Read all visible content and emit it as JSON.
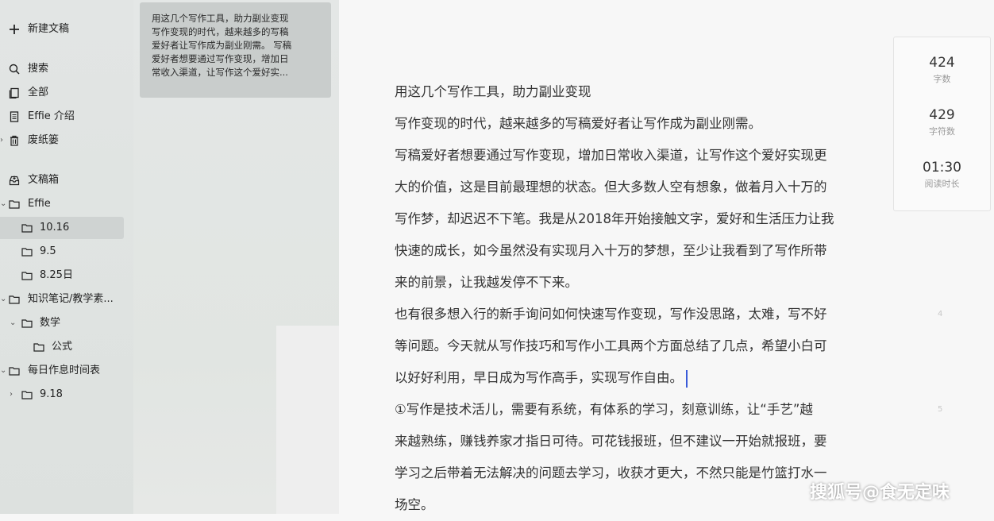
{
  "sidebar": {
    "new_doc": "新建文稿",
    "search": "搜索",
    "all": "全部",
    "intro": "Effie 介绍",
    "trash": "废纸篓",
    "inbox": "文稿箱",
    "folders": [
      {
        "label": "Effie"
      },
      {
        "label": "10.16"
      },
      {
        "label": "9.5"
      },
      {
        "label": "8.25日"
      },
      {
        "label": "知识笔记/教学素..."
      },
      {
        "label": "数学"
      },
      {
        "label": "公式"
      },
      {
        "label": "每日作息时间表"
      },
      {
        "label": "9.18"
      }
    ]
  },
  "card": {
    "lines": [
      "用这几个写作工具，助力副业变现",
      "写作变现的时代，越来越多的写稿",
      "爱好者让写作成为副业刚需。 写稿",
      "爱好者想要通过写作变现，增加日",
      "常收入渠道，让写作这个爱好实..."
    ]
  },
  "editor": {
    "lines": [
      "用这几个写作工具，助力副业变现",
      "写作变现的时代，越来越多的写稿爱好者让写作成为副业刚需。",
      "写稿爱好者想要通过写作变现，增加日常收入渠道，让写作这个爱好实现更",
      "大的价值，这是目前最理想的状态。但大多数人空有想象，做着月入十万的",
      "写作梦，却迟迟不下笔。我是从2018年开始接触文字，爱好和生活压力让我",
      "快速的成长，如今虽然没有实现月入十万的梦想，至少让我看到了写作所带",
      "来的前景，让我越发停不下来。",
      "也有很多想入行的新手询问如何快速写作变现，写作没思路，太难，写不好",
      "等问题。今天就从写作技巧和写作小工具两个方面总结了几点，希望小白可",
      "以好好利用，早日成为写作高手，实现写作自由。",
      "①写作是技术活儿，需要有系统，有体系的学习，刻意训练，让“手艺”越",
      "来越熟练，赚钱养家才指日可待。可花钱报班，但不建议一开始就报班，要",
      "学习之后带着无法解决的问题去学习，收获才更大，不然只能是竹篮打水一",
      "场空。"
    ],
    "para_num_1": "4",
    "para_num_2": "5"
  },
  "stats": {
    "words_value": "424",
    "words_label": "字数",
    "chars_value": "429",
    "chars_label": "字符数",
    "time_value": "01:30",
    "time_label": "阅读时长"
  },
  "watermark": "搜狐号@食无定味"
}
